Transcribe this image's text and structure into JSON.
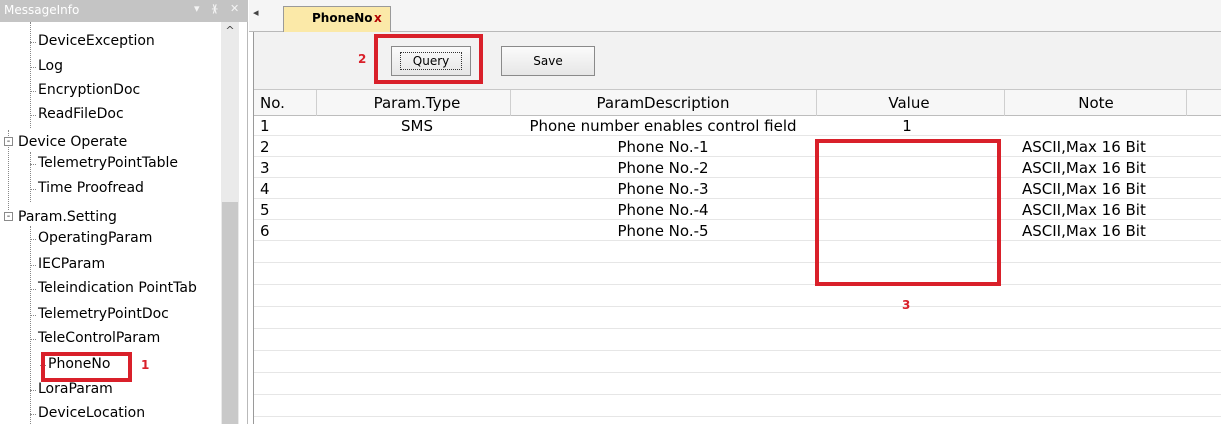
{
  "panel": {
    "title": "MessageInfo",
    "pin_glyph": "▾ ⊥ ✕"
  },
  "tree": {
    "items": [
      {
        "label": "DeviceException",
        "level": 2
      },
      {
        "label": "Log",
        "level": 2
      },
      {
        "label": "EncryptionDoc",
        "level": 2
      },
      {
        "label": "ReadFileDoc",
        "level": 2
      },
      {
        "label": "Device Operate",
        "level": 1,
        "expander": "-"
      },
      {
        "label": "TelemetryPointTable",
        "level": 2
      },
      {
        "label": "Time Proofread",
        "level": 2
      },
      {
        "label": "Param.Setting",
        "level": 1,
        "expander": "-"
      },
      {
        "label": "OperatingParam",
        "level": 2
      },
      {
        "label": "IECParam",
        "level": 2
      },
      {
        "label": "Teleindication PointTab",
        "level": 2
      },
      {
        "label": "TelemetryPointDoc",
        "level": 2
      },
      {
        "label": "TeleControlParam",
        "level": 2
      },
      {
        "label": "PhoneNo",
        "level": 2
      },
      {
        "label": "LoraParam",
        "level": 2
      },
      {
        "label": "DeviceLocation",
        "level": 2
      }
    ]
  },
  "tabs": {
    "nav_left": "◂",
    "active": {
      "label": "PhoneNo",
      "close": "x"
    }
  },
  "toolbar": {
    "query_label": "Query",
    "save_label": "Save"
  },
  "table": {
    "columns": [
      "No.",
      "Param.Type",
      "ParamDescription",
      "Value",
      "Note"
    ],
    "rows": [
      {
        "no": "1",
        "type": "SMS",
        "desc": "Phone number enables control field",
        "value": "1",
        "note": ""
      },
      {
        "no": "2",
        "type": "",
        "desc": "Phone No.-1",
        "value": "",
        "note": "ASCII,Max 16 Bit"
      },
      {
        "no": "3",
        "type": "",
        "desc": "Phone No.-2",
        "value": "",
        "note": "ASCII,Max 16 Bit"
      },
      {
        "no": "4",
        "type": "",
        "desc": "Phone No.-3",
        "value": "",
        "note": "ASCII,Max 16 Bit"
      },
      {
        "no": "5",
        "type": "",
        "desc": "Phone No.-4",
        "value": "",
        "note": "ASCII,Max 16 Bit"
      },
      {
        "no": "6",
        "type": "",
        "desc": "Phone No.-5",
        "value": "",
        "note": "ASCII,Max 16 Bit"
      }
    ]
  },
  "annotations": {
    "step1": "1",
    "step2": "2",
    "step3": "3",
    "color": "#d9202a"
  }
}
